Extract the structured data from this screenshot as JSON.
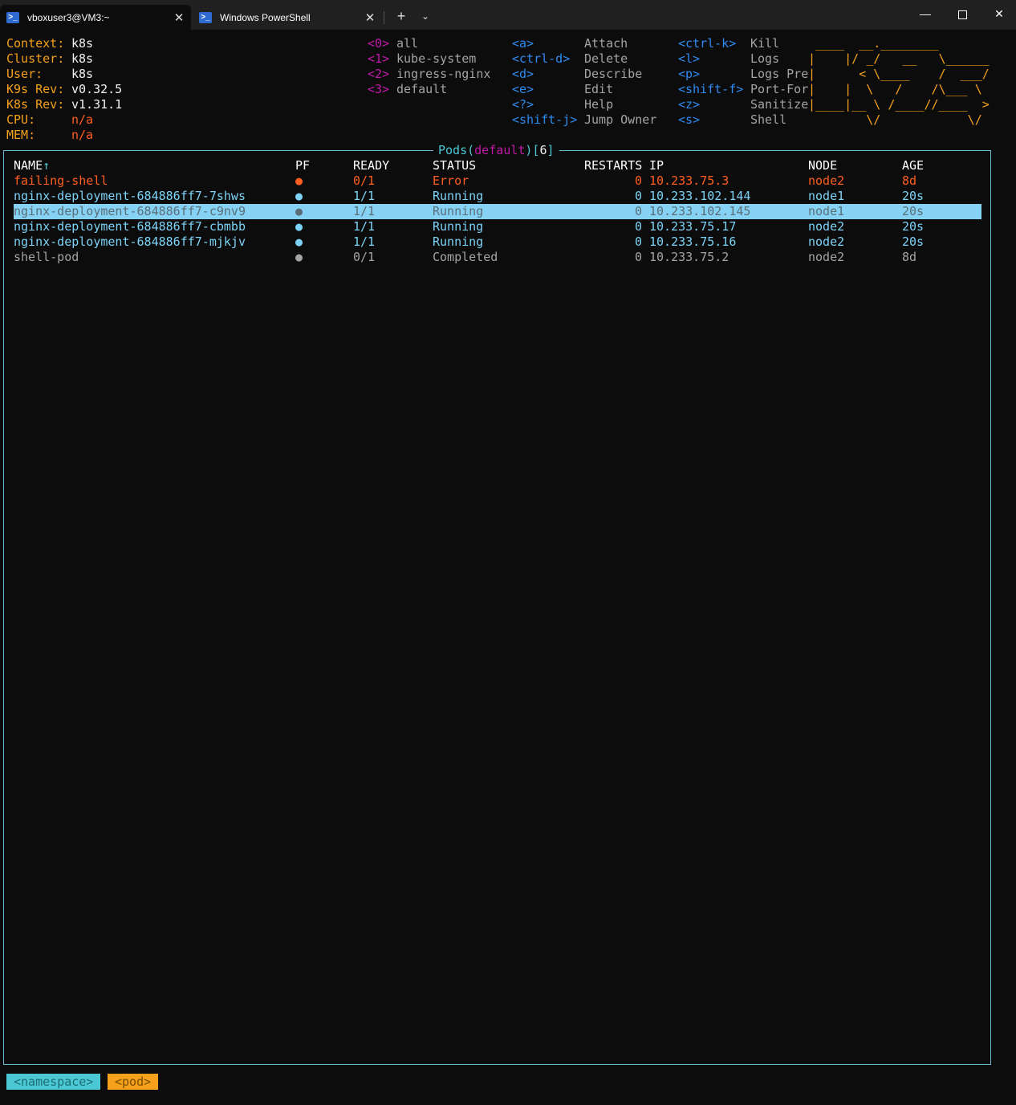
{
  "tabs": [
    {
      "label": "vboxuser3@VM3:~",
      "active": true
    },
    {
      "label": "Windows PowerShell",
      "active": false
    }
  ],
  "window_controls": {
    "minimize": "—",
    "close": "✕",
    "new_tab": "+",
    "dropdown": "⌄"
  },
  "info": [
    {
      "key": "Context:",
      "value": "k8s",
      "value_color": "white"
    },
    {
      "key": "Cluster:",
      "value": "k8s",
      "value_color": "white"
    },
    {
      "key": "User:",
      "value": "k8s",
      "value_color": "white"
    },
    {
      "key": "K9s Rev:",
      "value": "v0.32.5",
      "value_color": "white"
    },
    {
      "key": "K8s Rev:",
      "value": "v1.31.1",
      "value_color": "white"
    },
    {
      "key": "CPU:",
      "value": "n/a",
      "value_color": "red"
    },
    {
      "key": "MEM:",
      "value": "n/a",
      "value_color": "red"
    }
  ],
  "namespaces": [
    {
      "key": "<0>",
      "label": "all"
    },
    {
      "key": "<1>",
      "label": "kube-system"
    },
    {
      "key": "<2>",
      "label": "ingress-nginx"
    },
    {
      "key": "<3>",
      "label": "default"
    }
  ],
  "shortcuts_col1": [
    {
      "key": "<a>",
      "label": "Attach"
    },
    {
      "key": "<ctrl-d>",
      "label": "Delete"
    },
    {
      "key": "<d>",
      "label": "Describe"
    },
    {
      "key": "<e>",
      "label": "Edit"
    },
    {
      "key": "<?>",
      "label": "Help"
    },
    {
      "key": "<shift-j>",
      "label": "Jump Owner"
    }
  ],
  "shortcuts_col2": [
    {
      "key": "<ctrl-k>",
      "label": "Kill"
    },
    {
      "key": "<l>",
      "label": "Logs"
    },
    {
      "key": "<p>",
      "label": "Logs Pre"
    },
    {
      "key": "<shift-f>",
      "label": "Port-For"
    },
    {
      "key": "<z>",
      "label": "Sanitize"
    },
    {
      "key": "<s>",
      "label": "Shell"
    }
  ],
  "logo": " ____  __.________       \n|    |/ _/   __   \\______\n|      < \\____    /  ___/\n|    |  \\   /    /\\___ \\ \n|____|__ \\ /____//____  >\n        \\/            \\/ ",
  "frame": {
    "resource": "Pods",
    "namespace": "default",
    "count": "6"
  },
  "columns": {
    "name": "NAME",
    "sort_indicator": "↑",
    "pf": "PF",
    "ready": "READY",
    "status": "STATUS",
    "restarts": "RESTARTS",
    "ip": "IP",
    "node": "NODE",
    "age": "AGE"
  },
  "pods": [
    {
      "name": "failing-shell",
      "pf": "●",
      "ready": "0/1",
      "status": "Error",
      "restarts": "0",
      "ip": "10.233.75.3",
      "node": "node2",
      "age": "8d",
      "color": "#ff5e1f",
      "selected": false
    },
    {
      "name": "nginx-deployment-684886ff7-7shws",
      "pf": "●",
      "ready": "1/1",
      "status": "Running",
      "restarts": "0",
      "ip": "10.233.102.144",
      "node": "node1",
      "age": "20s",
      "color": "#7dd3f7",
      "selected": false
    },
    {
      "name": "nginx-deployment-684886ff7-c9nv9",
      "pf": "●",
      "ready": "1/1",
      "status": "Running",
      "restarts": "0",
      "ip": "10.233.102.145",
      "node": "node1",
      "age": "20s",
      "color": "#5a6e78",
      "selected": true
    },
    {
      "name": "nginx-deployment-684886ff7-cbmbb",
      "pf": "●",
      "ready": "1/1",
      "status": "Running",
      "restarts": "0",
      "ip": "10.233.75.17",
      "node": "node2",
      "age": "20s",
      "color": "#7dd3f7",
      "selected": false
    },
    {
      "name": "nginx-deployment-684886ff7-mjkjv",
      "pf": "●",
      "ready": "1/1",
      "status": "Running",
      "restarts": "0",
      "ip": "10.233.75.16",
      "node": "node2",
      "age": "20s",
      "color": "#7dd3f7",
      "selected": false
    },
    {
      "name": "shell-pod",
      "pf": "●",
      "ready": "0/1",
      "status": "Completed",
      "restarts": "0",
      "ip": "10.233.75.2",
      "node": "node2",
      "age": "8d",
      "color": "#a4a4a4",
      "selected": false
    }
  ],
  "breadcrumbs": [
    "<namespace>",
    "<pod>"
  ]
}
